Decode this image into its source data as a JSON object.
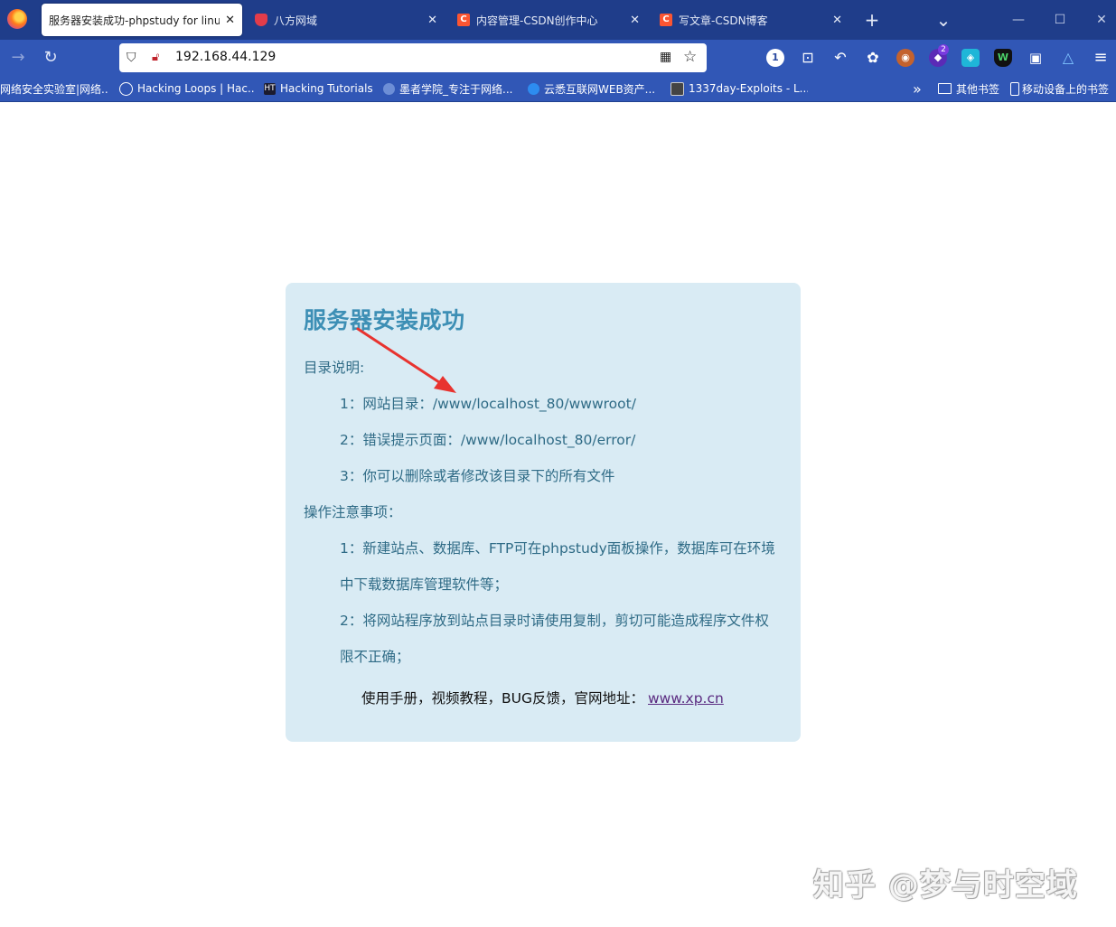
{
  "tabs": [
    {
      "title": "服务器安装成功-phpstudy for linu",
      "active": true,
      "favicon": "firefox-globe"
    },
    {
      "title": "八方网域",
      "active": false,
      "favicon": "shield-icon"
    },
    {
      "title": "内容管理-CSDN创作中心",
      "active": false,
      "favicon": "csdn-icon"
    },
    {
      "title": "写文章-CSDN博客",
      "active": false,
      "favicon": "csdn-icon"
    }
  ],
  "csdn_letter": "C",
  "tab_close": "✕",
  "new_tab": "+",
  "tab_list": "⌄",
  "window": {
    "minimize": "—",
    "maximize": "☐",
    "close": "✕"
  },
  "nav": {
    "back": "←",
    "forward": "→",
    "reload": "↻"
  },
  "url": "192.168.44.129",
  "extensions": [
    {
      "name": "counter-extension",
      "label": "1"
    },
    {
      "name": "crop-extension",
      "label": "⊡"
    },
    {
      "name": "undo-extension",
      "label": "↶"
    },
    {
      "name": "cookie-extension",
      "label": "✿"
    },
    {
      "name": "wappalyzer-extension",
      "label": "◉"
    },
    {
      "name": "hackbar-extension",
      "label": "◆",
      "badge": "2"
    },
    {
      "name": "proxy-extension",
      "label": "◈"
    },
    {
      "name": "w-extension",
      "label": "W"
    },
    {
      "name": "screenshot-extension",
      "label": "▣"
    },
    {
      "name": "triangle-extension",
      "label": "△"
    },
    {
      "name": "menu-extension",
      "label": "≡"
    }
  ],
  "bookmarks": [
    {
      "label": "网络安全实验室|网络...",
      "icon": "globe-icon"
    },
    {
      "label": "Hacking Loops | Hac...",
      "icon": "globe-icon"
    },
    {
      "label": "Hacking Tutorials",
      "icon": "ht-icon",
      "icon_text": "HT"
    },
    {
      "label": "墨者学院_专注于网络...",
      "icon": "mozhe-icon"
    },
    {
      "label": "云悉互联网WEB资产...",
      "icon": "yunxi-icon"
    },
    {
      "label": "1337day-Exploits - L...",
      "icon": "1337day-icon"
    }
  ],
  "bookmarks_overflow": "»",
  "bookmark_folders": [
    {
      "label": "其他书签",
      "icon": "folder-icon"
    },
    {
      "label": "移动设备上的书签",
      "icon": "mobile-icon"
    }
  ],
  "page": {
    "heading": "服务器安装成功",
    "dir_title": "目录说明:",
    "dir_items": [
      "1：网站目录：/www/localhost_80/wwwroot/",
      "2：错误提示页面：/www/localhost_80/error/",
      "3：你可以删除或者修改该目录下的所有文件"
    ],
    "notes_title": "操作注意事项：",
    "notes": [
      {
        "line1": "1：新建站点、数据库、FTP可在phpstudy面板操作，数据库可在环境",
        "line2": "中下载数据库管理软件等；"
      },
      {
        "line1": "2：将网站程序放到站点目录时请使用复制，剪切可能造成程序文件权",
        "line2": "限不正确；"
      }
    ],
    "footer_text": "使用手册，视频教程，BUG反馈，官网地址：",
    "footer_link": "www.xp.cn"
  },
  "watermark": "知乎 @梦与时空域",
  "colors": {
    "tab_bar": "#1f3d8a",
    "toolbar": "#3157b6",
    "box_bg": "#d9ebf4",
    "heading": "#3d8fb5",
    "body_text": "#2f6b86",
    "arrow": "#e8332f"
  }
}
